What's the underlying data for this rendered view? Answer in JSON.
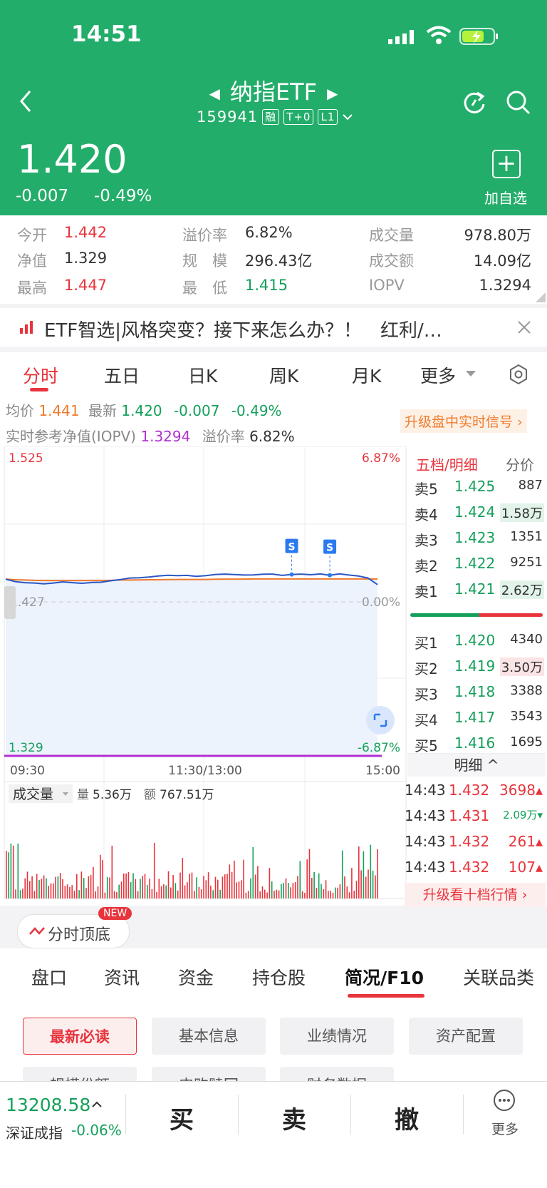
{
  "status": {
    "time": "14:51"
  },
  "header": {
    "title": "纳指ETF",
    "code": "159941",
    "tags": [
      "融",
      "T+0",
      "L1"
    ],
    "price": "1.420",
    "change": "-0.007",
    "change_pct": "-0.49%",
    "add_label": "加自选",
    "add_symbol": "+"
  },
  "quote": [
    {
      "label": "今开",
      "value": "1.442",
      "color": "red"
    },
    {
      "label": "溢价率",
      "value": "6.82%",
      "color": "normal"
    },
    {
      "label": "成交量",
      "value": "978.80万",
      "color": "normal"
    },
    {
      "label": "净值",
      "value": "1.329",
      "color": "normal"
    },
    {
      "label": "规　模",
      "value": "296.43亿",
      "color": "normal"
    },
    {
      "label": "成交额",
      "value": "14.09亿",
      "color": "normal"
    },
    {
      "label": "最高",
      "value": "1.447",
      "color": "red"
    },
    {
      "label": "最　低",
      "value": "1.415",
      "color": "green"
    },
    {
      "label": "IOPV",
      "value": "1.3294",
      "color": "normal"
    }
  ],
  "news": {
    "text": "ETF智选|风格突变？接下来怎么办？！　红利/…"
  },
  "ktabs": [
    "分时",
    "五日",
    "日K",
    "周K",
    "月K",
    "更多"
  ],
  "info": {
    "avg_label": "均价",
    "avg": "1.441",
    "latest_label": "最新",
    "latest": "1.420",
    "chg": "-0.007",
    "chg_pct": "-0.49%",
    "iopv_label": "实时参考净值(IOPV)",
    "iopv": "1.3294",
    "prem_label": "溢价率",
    "prem": "6.82%",
    "upgrade": "升级盘中实时信号"
  },
  "chart_data": {
    "type": "line",
    "title": "",
    "xlabel": "",
    "ylabel": "",
    "x_ticks": [
      "09:30",
      "11:30/13:00",
      "15:00"
    ],
    "ylim": [
      1.329,
      1.525
    ],
    "y_left_labels": [
      "1.525",
      "1.427",
      "1.329"
    ],
    "y_right_labels": [
      "6.87%",
      "0.00%",
      "-6.87%"
    ],
    "series": [],
    "price": [
      1.4416,
      1.44,
      1.4393,
      1.4391,
      1.4386,
      1.4391,
      1.4398,
      1.4393,
      1.4389,
      1.4394,
      1.4396,
      1.4405,
      1.4413,
      1.4423,
      1.4425,
      1.4429,
      1.4436,
      1.4441,
      1.4438,
      1.444,
      1.4434,
      1.4438,
      1.4446,
      1.4448,
      1.4445,
      1.4442,
      1.4443,
      1.4447,
      1.4448,
      1.444,
      1.4446,
      1.4448,
      1.4444,
      1.4449,
      1.4441,
      1.445,
      1.4442,
      1.4436,
      1.4423,
      1.4381
    ],
    "avg": [
      1.4416,
      1.4412,
      1.441,
      1.4408,
      1.4407,
      1.4407,
      1.4406,
      1.4407,
      1.4407,
      1.4407,
      1.4407,
      1.4408,
      1.441,
      1.441,
      1.4411,
      1.4412,
      1.4412,
      1.4413,
      1.4414,
      1.4414,
      1.4414,
      1.4414,
      1.4415,
      1.4416,
      1.4416,
      1.4416,
      1.4417,
      1.4417,
      1.4417,
      1.4417,
      1.4417,
      1.4417,
      1.4417,
      1.4417,
      1.4417,
      1.4417,
      1.4417,
      1.4417,
      1.4417,
      1.4416
    ],
    "volume_header": {
      "label": "成交量",
      "vol_label": "量",
      "vol": "5.36万",
      "amt_label": "额",
      "amt": "767.51万"
    },
    "signals": [
      "S",
      "S"
    ]
  },
  "orderbook": {
    "header": [
      "五档/明细",
      "分价"
    ],
    "asks": [
      {
        "label": "卖5",
        "price": "1.425",
        "vol": "887"
      },
      {
        "label": "卖4",
        "price": "1.424",
        "vol": "1.58万"
      },
      {
        "label": "卖3",
        "price": "1.423",
        "vol": "1351"
      },
      {
        "label": "卖2",
        "price": "1.422",
        "vol": "9251"
      },
      {
        "label": "卖1",
        "price": "1.421",
        "vol": "2.62万"
      }
    ],
    "bids": [
      {
        "label": "买1",
        "price": "1.420",
        "vol": "4340"
      },
      {
        "label": "买2",
        "price": "1.419",
        "vol": "3.50万"
      },
      {
        "label": "买3",
        "price": "1.418",
        "vol": "3388"
      },
      {
        "label": "买4",
        "price": "1.417",
        "vol": "3543"
      },
      {
        "label": "买5",
        "price": "1.416",
        "vol": "1695"
      }
    ],
    "detail_label": "明细",
    "details": [
      {
        "time": "14:43",
        "price": "1.432",
        "vol": "3698",
        "dir": "up"
      },
      {
        "time": "14:43",
        "price": "1.431",
        "vol": "2.09万",
        "dir": "down"
      },
      {
        "time": "14:43",
        "price": "1.432",
        "vol": "261",
        "dir": "up"
      },
      {
        "time": "14:43",
        "price": "1.432",
        "vol": "107",
        "dir": "up"
      }
    ],
    "upgrade": "升级看十档行情"
  },
  "fenshi": {
    "label": "分时顶底",
    "badge": "NEW"
  },
  "bottom_tabs": [
    "盘口",
    "资讯",
    "资金",
    "持仓股",
    "简况/F10",
    "关联品类"
  ],
  "chips": [
    "最新必读",
    "基本信息",
    "业绩情况",
    "资产配置"
  ],
  "chips_partial": [
    "规模份额",
    "申购赎回",
    "财务数据"
  ],
  "footer": {
    "index_value": "13208.58",
    "index_name": "深证成指",
    "index_chg": "-0.06%",
    "buy": "买",
    "sell": "卖",
    "cancel": "撤",
    "more": "更多"
  }
}
